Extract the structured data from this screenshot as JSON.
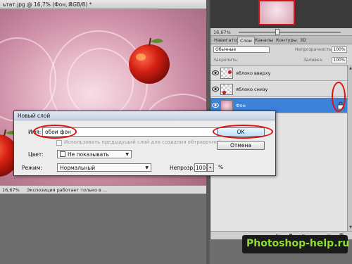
{
  "document": {
    "tab_title": "ьтат.jpg @ 16,7% (Фон, RGB/8) *",
    "close_glyph": "×",
    "status_zoom": "16,67%",
    "status_text": "Экспозиция работает только в ..."
  },
  "panel": {
    "zoom_value": "16,67%",
    "tabs": [
      {
        "label": "Навигатор",
        "active": false
      },
      {
        "label": "Слои",
        "active": true
      },
      {
        "label": "Каналы",
        "active": false
      },
      {
        "label": "Контуры",
        "active": false
      },
      {
        "label": "3D",
        "active": false
      }
    ],
    "blend_mode": "Обычные",
    "opacity_label": "Непрозрачность:",
    "opacity_value": "100%",
    "lock_label": "Закрепить:",
    "fill_label": "Заливка:",
    "fill_value": "100%",
    "layers": [
      {
        "name": "яблоко вверху",
        "selected": false,
        "thumb": "transparent"
      },
      {
        "name": "яблоко снизу",
        "selected": false,
        "thumb": "transparent"
      },
      {
        "name": "Фон",
        "selected": true,
        "thumb": "background",
        "locked": true
      }
    ],
    "footer_icons": [
      "link-icon",
      "fx-icon",
      "mask-icon",
      "adjustment-icon",
      "group-icon",
      "new-layer-icon",
      "trash-icon"
    ],
    "footer_glyphs": [
      "∞",
      "fx",
      "◘",
      "◐",
      "▭",
      "▢",
      "🗑"
    ]
  },
  "dialog": {
    "title": "Новый слой",
    "name_label": "Имя:",
    "name_value": "обои фон",
    "clip_label": "Использовать предыдущий слой для создания обтравочной маски",
    "color_label": "Цвет:",
    "color_value": "Не показывать",
    "mode_label": "Режим:",
    "mode_value": "Нормальный",
    "opacity_label": "Непрозр.:",
    "opacity_value": "100",
    "opacity_unit": "%",
    "ok_label": "OK",
    "cancel_label": "Отмена"
  },
  "watermark": {
    "text": "Photoshop-help.ru"
  },
  "colors": {
    "highlight": "#e01010",
    "selected_layer": "#3d82d8",
    "watermark_text": "#8ee02c"
  }
}
